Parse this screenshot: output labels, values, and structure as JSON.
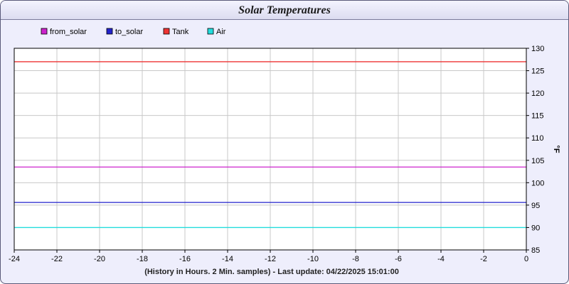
{
  "window": {
    "title": "Solar Temperatures"
  },
  "chart_data": {
    "type": "line",
    "title": "Solar Temperatures",
    "xlabel": "(History in Hours. 2 Min. samples) - Last update: 04/22/2025 15:01:00",
    "ylabel": "°F",
    "xlim": [
      -24,
      0
    ],
    "ylim": [
      85,
      130
    ],
    "x_ticks": [
      -24,
      -22,
      -20,
      -18,
      -16,
      -14,
      -12,
      -10,
      -8,
      -6,
      -4,
      -2,
      0
    ],
    "y_ticks": [
      85,
      90,
      95,
      100,
      105,
      110,
      115,
      120,
      125,
      130
    ],
    "grid": true,
    "legend_position": "top-left",
    "series": [
      {
        "name": "from_solar",
        "color": "#cc22cc",
        "x": [
          -24,
          0
        ],
        "values": [
          103.5,
          103.5
        ]
      },
      {
        "name": "to_solar",
        "color": "#2222cc",
        "x": [
          -24,
          0
        ],
        "values": [
          95.6,
          95.6
        ]
      },
      {
        "name": "Tank",
        "color": "#ee3333",
        "x": [
          -24,
          0
        ],
        "values": [
          127,
          127
        ]
      },
      {
        "name": "Air",
        "color": "#22dddd",
        "x": [
          -24,
          0
        ],
        "values": [
          90,
          90
        ]
      }
    ]
  }
}
